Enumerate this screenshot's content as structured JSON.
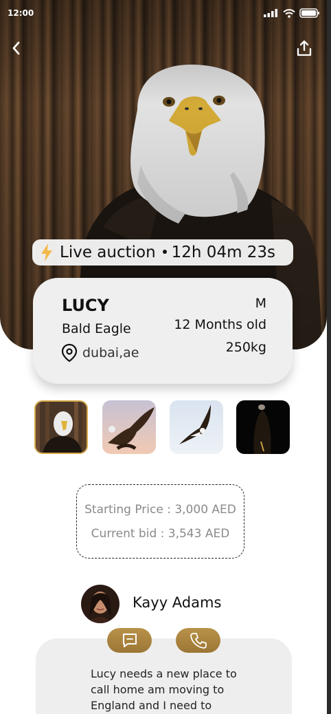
{
  "status_bar": {
    "time": "12:00"
  },
  "auction": {
    "label": "Live auction",
    "countdown": "12h 04m 23s"
  },
  "bird": {
    "name": "LUCY",
    "species": "Bald Eagle",
    "location": "dubai,ae",
    "sex": "M",
    "age": "12 Months old",
    "weight": "250kg"
  },
  "gallery": {
    "selected_index": 0,
    "items": [
      {
        "icon": "eagle-portrait-photo"
      },
      {
        "icon": "eagle-flying-sunset-photo"
      },
      {
        "icon": "eagle-flying-sky-photo"
      },
      {
        "icon": "eagle-dark-photo"
      }
    ]
  },
  "pricing": {
    "starting": "Starting Price : 3,000 AED",
    "current": "Current bid : 3,543 AED"
  },
  "seller": {
    "name": "Kayy Adams",
    "description": "Lucy needs a new place to call home  am moving to England  and I need to"
  },
  "colors": {
    "accent": "#b8924a",
    "card": "#efefef",
    "selected_border": "#d4a94a"
  },
  "icons": {
    "back": "chevron-left-icon",
    "share": "share-icon",
    "bolt": "lightning-icon",
    "location": "location-pin-icon",
    "message": "chat-icon",
    "call": "phone-icon"
  }
}
